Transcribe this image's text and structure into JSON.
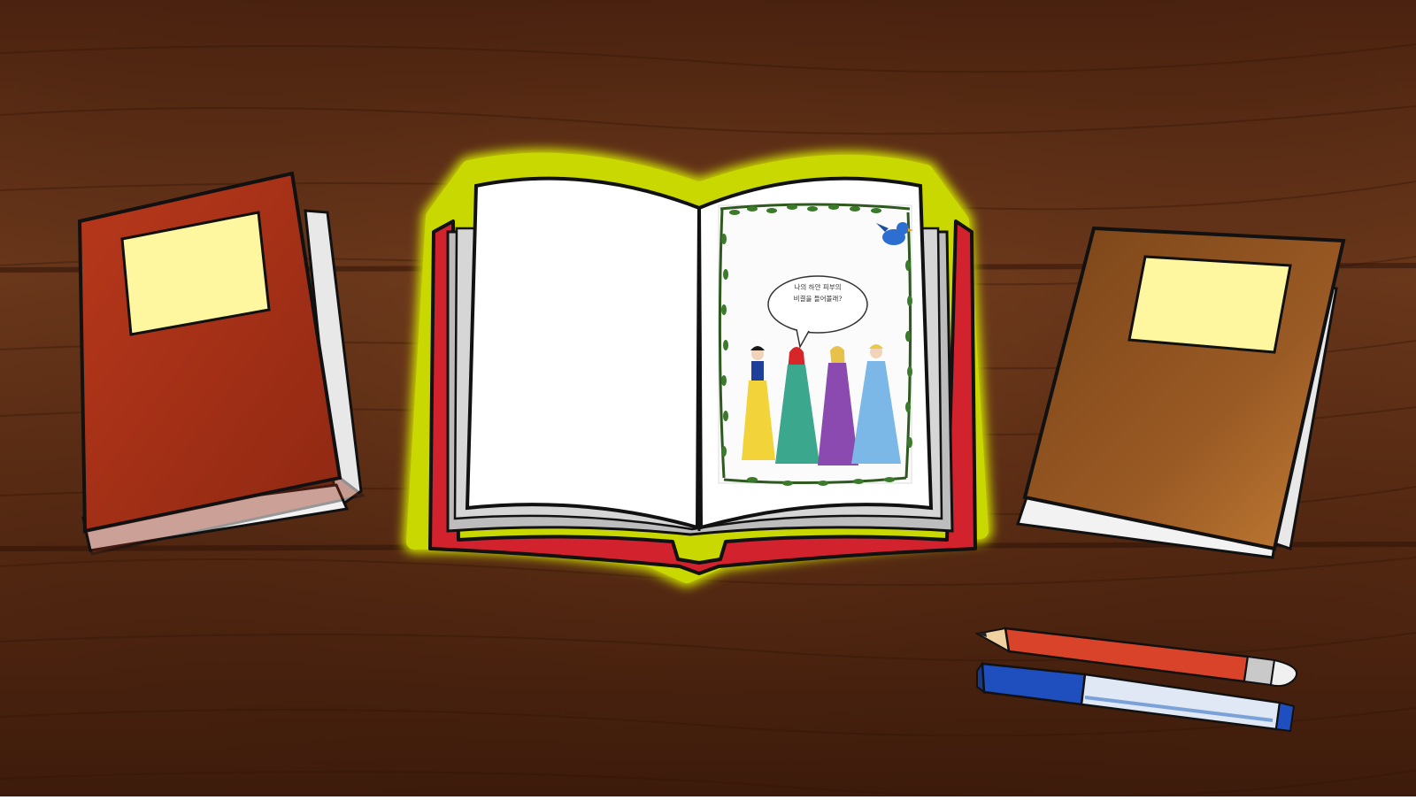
{
  "scene": {
    "colors": {
      "table": "#5a2c14",
      "table_light": "#7a4020",
      "book_glow": "#c8d800",
      "book_cover": "#c8202a",
      "left_book_cover": "#a33217",
      "right_book_cover": "#a0622a",
      "label": "#fff7a0",
      "pencil_body": "#d9432a",
      "pen_body": "#1f4fbf"
    },
    "left_book": {
      "icon": "closed-book-icon"
    },
    "right_book": {
      "icon": "closed-book-icon"
    },
    "open_book": {
      "left_page": {
        "content": ""
      },
      "right_page": {
        "speech_bubble": "나의 하얀 피부의\n비결을 들어볼래?",
        "characters_icon": "four-princesses-illustration",
        "bird_icon": "bluebird-icon",
        "frame_icon": "leafy-vine-frame"
      }
    },
    "pencil": {
      "icon": "pencil-icon"
    },
    "pen": {
      "icon": "pen-icon"
    }
  }
}
